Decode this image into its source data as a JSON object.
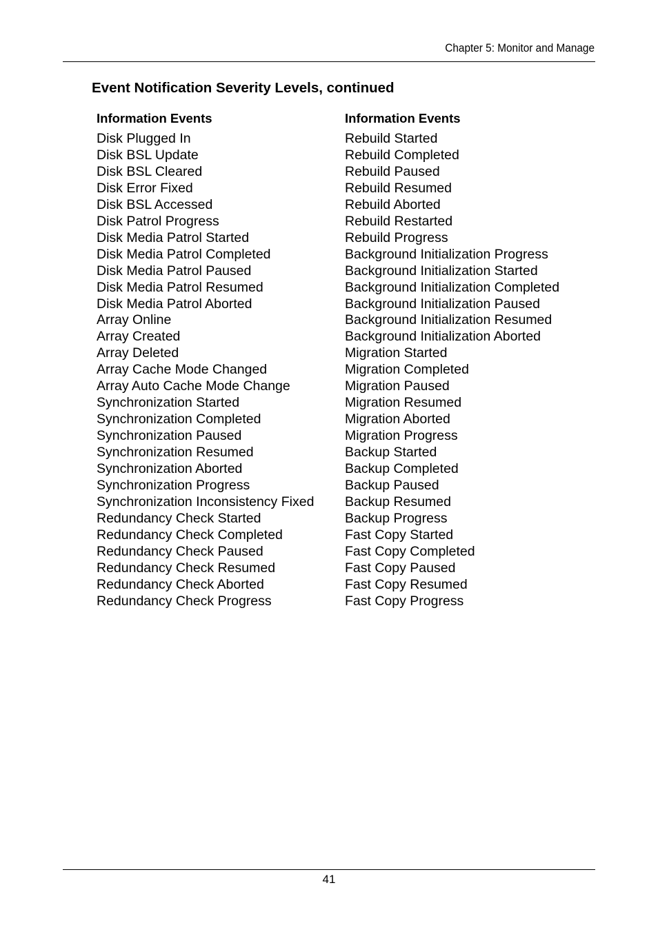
{
  "header": {
    "chapter": "Chapter 5: Monitor and Manage"
  },
  "section": {
    "title": "Event Notification Severity Levels, continued"
  },
  "columns": [
    {
      "heading": "Information Events",
      "items": [
        "Disk Plugged In",
        "Disk BSL Update",
        "Disk BSL Cleared",
        "Disk Error Fixed",
        "Disk BSL Accessed",
        "Disk Patrol Progress",
        "Disk Media Patrol Started",
        "Disk Media Patrol Completed",
        "Disk Media Patrol Paused",
        "Disk Media Patrol Resumed",
        "Disk Media Patrol Aborted",
        "Array Online",
        "Array Created",
        "Array Deleted",
        "Array Cache Mode Changed",
        "Array Auto Cache Mode Change",
        "Synchronization Started",
        "Synchronization Completed",
        "Synchronization Paused",
        "Synchronization Resumed",
        "Synchronization Aborted",
        "Synchronization Progress",
        "Synchronization Inconsistency Fixed",
        "Redundancy Check Started",
        "Redundancy Check Completed",
        "Redundancy Check Paused",
        "Redundancy Check Resumed",
        "Redundancy Check Aborted",
        "Redundancy Check Progress"
      ]
    },
    {
      "heading": "Information Events",
      "items": [
        "Rebuild Started",
        "Rebuild Completed",
        "Rebuild Paused",
        "Rebuild Resumed",
        "Rebuild Aborted",
        "Rebuild Restarted",
        "Rebuild Progress",
        "Background Initialization Progress",
        "Background Initialization Started",
        "Background Initialization Completed",
        "Background Initialization Paused",
        "Background Initialization Resumed",
        "Background Initialization Aborted",
        "Migration Started",
        "Migration Completed",
        "Migration Paused",
        "Migration Resumed",
        "Migration Aborted",
        "Migration Progress",
        "Backup Started",
        "Backup Completed",
        "Backup Paused",
        "Backup Resumed",
        "Backup Progress",
        "Fast Copy Started",
        "Fast Copy Completed",
        "Fast Copy Paused",
        "Fast Copy Resumed",
        "Fast Copy Progress"
      ]
    }
  ],
  "footer": {
    "page_number": "41"
  }
}
